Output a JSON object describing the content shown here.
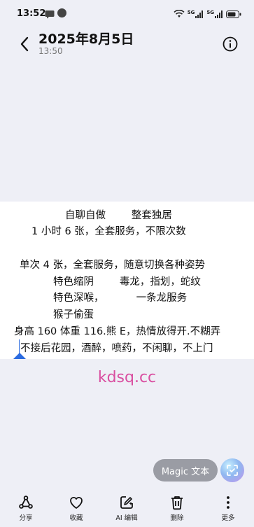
{
  "status_bar": {
    "time": "13:52",
    "signal_label_1": "5G",
    "signal_label_2": "5G"
  },
  "header": {
    "title": "2025年8月5日",
    "subtitle": "13:50"
  },
  "image_text": {
    "lines": [
      "自聊自做        整套独居",
      "1 小时 6 张，全套服务，不限次数",
      "单次 4 张，全套服务，随意切换各种姿势",
      "特色缩阴        毒龙，指划，蛇纹",
      "特色深喉，          一条龙服务",
      "猴子偷蛋",
      "身高 160 体重 116.熊 E，热情放得开.不糊弄",
      "不接后花园，酒醉，喷药，不闲聊，不上门"
    ]
  },
  "watermark": "kdsq.cc",
  "magic_button": {
    "label": "Magic 文本"
  },
  "toolbar": {
    "share": "分享",
    "favorite": "收藏",
    "ai_edit": "AI 编辑",
    "delete": "删除",
    "more": "更多"
  },
  "colors": {
    "background": "#eeeff6",
    "watermark": "#d94ea0",
    "accent": "#2b6be0"
  }
}
